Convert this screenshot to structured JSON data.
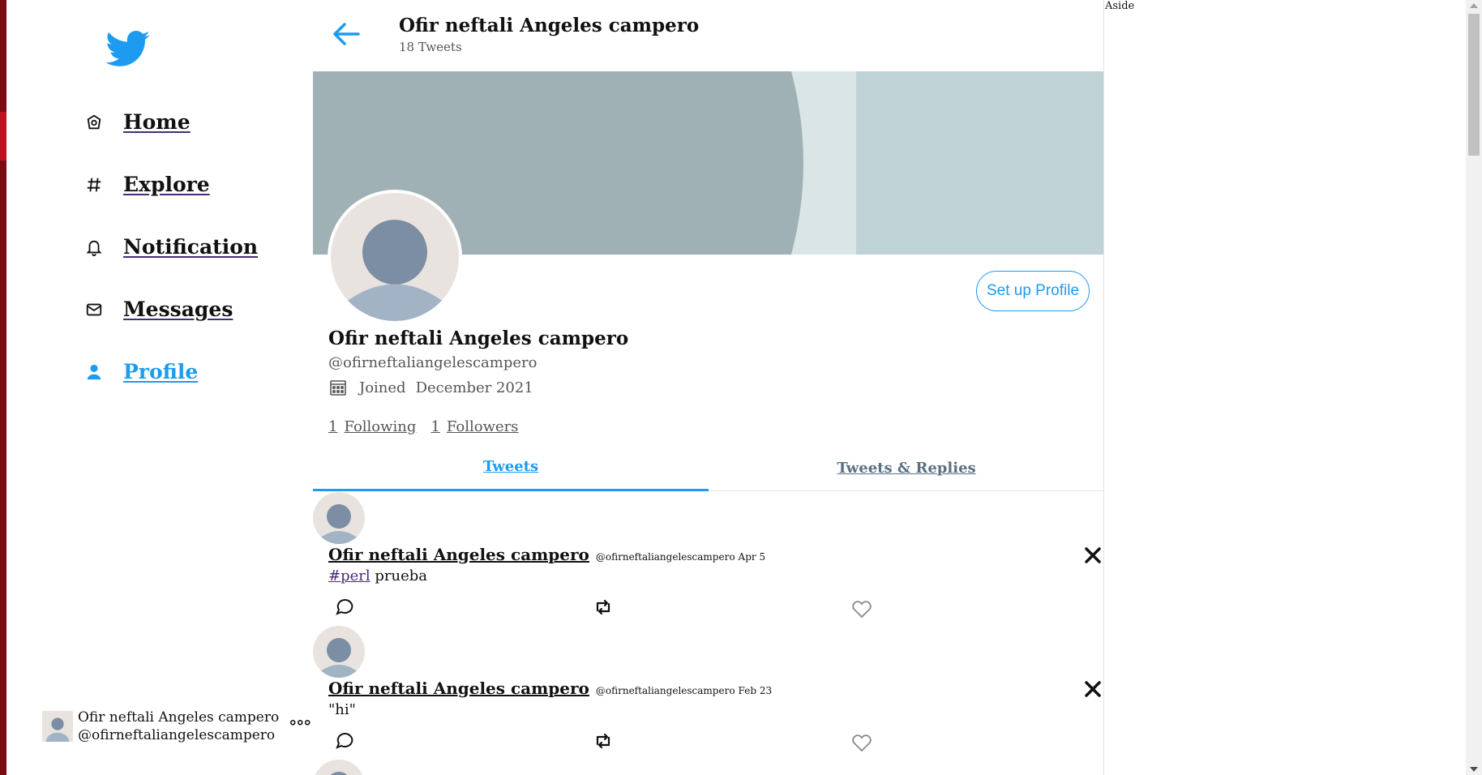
{
  "nav": {
    "items": [
      {
        "label": "Home",
        "icon": "home-icon"
      },
      {
        "label": "Explore",
        "icon": "hashtag-icon"
      },
      {
        "label": "Notification",
        "icon": "bell-icon"
      },
      {
        "label": "Messages",
        "icon": "mail-icon"
      },
      {
        "label": "Profile",
        "icon": "person-icon",
        "active": true
      }
    ],
    "account": {
      "name": "Ofir neftali Angeles campero",
      "handle": "@ofirneftaliangelescampero",
      "more": "°°°"
    }
  },
  "header": {
    "title": "Ofir neftali Angeles campero",
    "tweet_count": "18 Tweets"
  },
  "profile": {
    "name": "Ofir neftali Angeles campero",
    "handle": "@ofirneftaliangelescampero",
    "joined_label": "Joined",
    "joined_date": "December 2021",
    "following_count": "1",
    "following_label": "Following",
    "followers_count": "1",
    "followers_label": "Followers",
    "setup_button": "Set up Profile"
  },
  "tabs": {
    "tweets": "Tweets",
    "replies": "Tweets & Replies"
  },
  "tweets": [
    {
      "name": "Ofir neftali Angeles campero",
      "handle": "@ofirneftaliangelescampero",
      "date": "Apr 5",
      "hashtag": "#perl",
      "text": " prueba"
    },
    {
      "name": "Ofir neftali Angeles campero",
      "handle": "@ofirneftaliangelescampero",
      "date": "Feb 23",
      "hashtag": "",
      "text": "\"hi\""
    }
  ],
  "aside": {
    "label": "Aside"
  },
  "colors": {
    "accent": "#1d9bf0",
    "banner_dark": "#a0b1b5",
    "banner_light": "#bfd2d6",
    "avatar_bg": "#e8e3de",
    "avatar_fg": "#7c8ea3"
  }
}
